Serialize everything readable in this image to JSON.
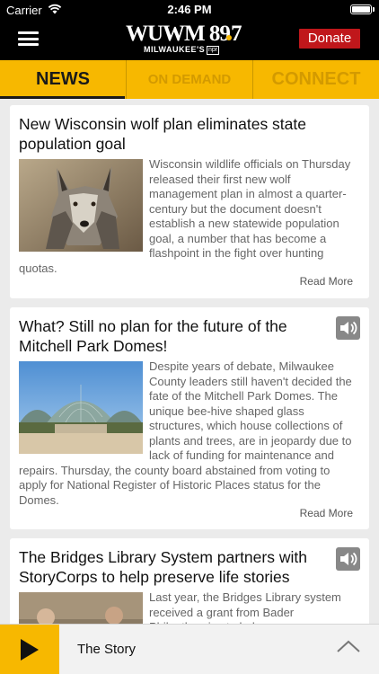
{
  "status": {
    "carrier": "Carrier",
    "time": "2:46 PM"
  },
  "header": {
    "logo_main": "WUWM 89",
    "logo_sub": "MILWAUKEE'S",
    "logo_npr": "npr",
    "donate_label": "Donate"
  },
  "tabs": [
    {
      "label": "NEWS",
      "active": true
    },
    {
      "label": "ON DEMAND",
      "active": false
    },
    {
      "label": "CONNECT",
      "active": false
    }
  ],
  "articles": [
    {
      "title": "New Wisconsin wolf plan eliminates state population goal",
      "summary": "Wisconsin wildlife officials on Thursday released their first new wolf management plan in almost a quarter-century but the document doesn't establish a new statewide population goal, a number that has become a flashpoint in the fight over hunting quotas.",
      "read_more": "Read More",
      "has_audio": false
    },
    {
      "title": "What? Still no plan for the future of the Mitchell Park Domes!",
      "summary": "Despite years of debate, Milwaukee County leaders still haven't decided the fate of the Mitchell Park Domes. The unique bee-hive shaped glass structures, which house collections of plants and trees, are in jeopardy due to lack of funding for maintenance and repairs. Thursday, the county board abstained from voting to apply for National Register of Historic Places status for the Domes.",
      "read_more": "Read More",
      "has_audio": true
    },
    {
      "title": "The Bridges Library System partners with StoryCorps to help preserve life stories",
      "summary": "Last year, the Bridges Library system received a grant from Bader Philanthropies to help ...",
      "has_audio": true
    }
  ],
  "player": {
    "title": "The Story"
  },
  "colors": {
    "accent": "#f7b800",
    "donate": "#c0171b",
    "header": "#000000"
  }
}
